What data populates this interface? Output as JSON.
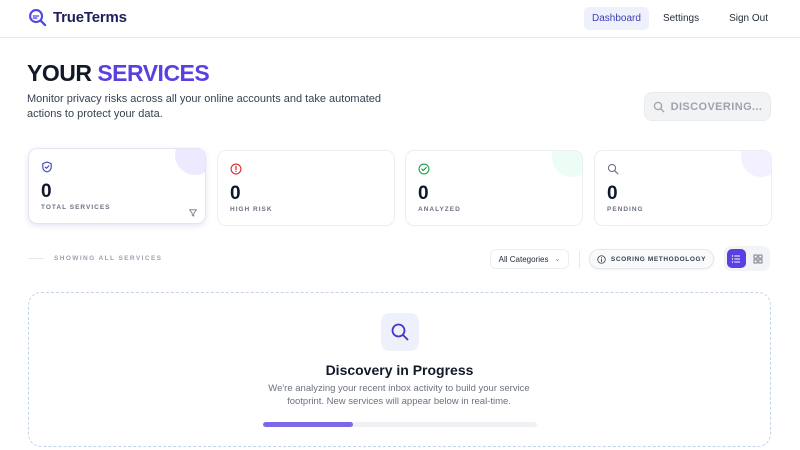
{
  "app": {
    "name": "TrueTerms"
  },
  "nav": {
    "dashboard": "Dashboard",
    "settings": "Settings",
    "sign_out": "Sign Out"
  },
  "hero": {
    "title_part1": "YOUR ",
    "title_part2": "SERVICES",
    "subtitle": "Monitor privacy risks across all your online accounts and take automated actions to protect your data.",
    "discover_label": "DISCOVERING..."
  },
  "stats": [
    {
      "value": "0",
      "label": "TOTAL SERVICES",
      "icon": "shield-check-icon",
      "color": "#3b3fb6",
      "blob": "#ede9fe"
    },
    {
      "value": "0",
      "label": "HIGH RISK",
      "icon": "alert-circle-icon",
      "color": "#dc2626",
      "blob": "#ffffff"
    },
    {
      "value": "0",
      "label": "ANALYZED",
      "icon": "check-circle-icon",
      "color": "#16a34a",
      "blob": "#ecfdf5"
    },
    {
      "value": "0",
      "label": "PENDING",
      "icon": "search-icon",
      "color": "#6b7280",
      "blob": "#f3f0ff"
    }
  ],
  "filters": {
    "showing_label": "SHOWING ALL SERVICES",
    "category_selected": "All Categories",
    "methodology_label": "SCORING METHODOLOGY",
    "view_modes": [
      "list-view",
      "grid-view"
    ],
    "active_view": "list-view"
  },
  "discovery": {
    "title": "Discovery in Progress",
    "text": "We're analyzing your recent inbox activity to build your service footprint. New services will appear below in real-time.",
    "progress": 0.33
  },
  "colors": {
    "accent": "#5b3fe0",
    "brand": "#1f1f5c"
  }
}
